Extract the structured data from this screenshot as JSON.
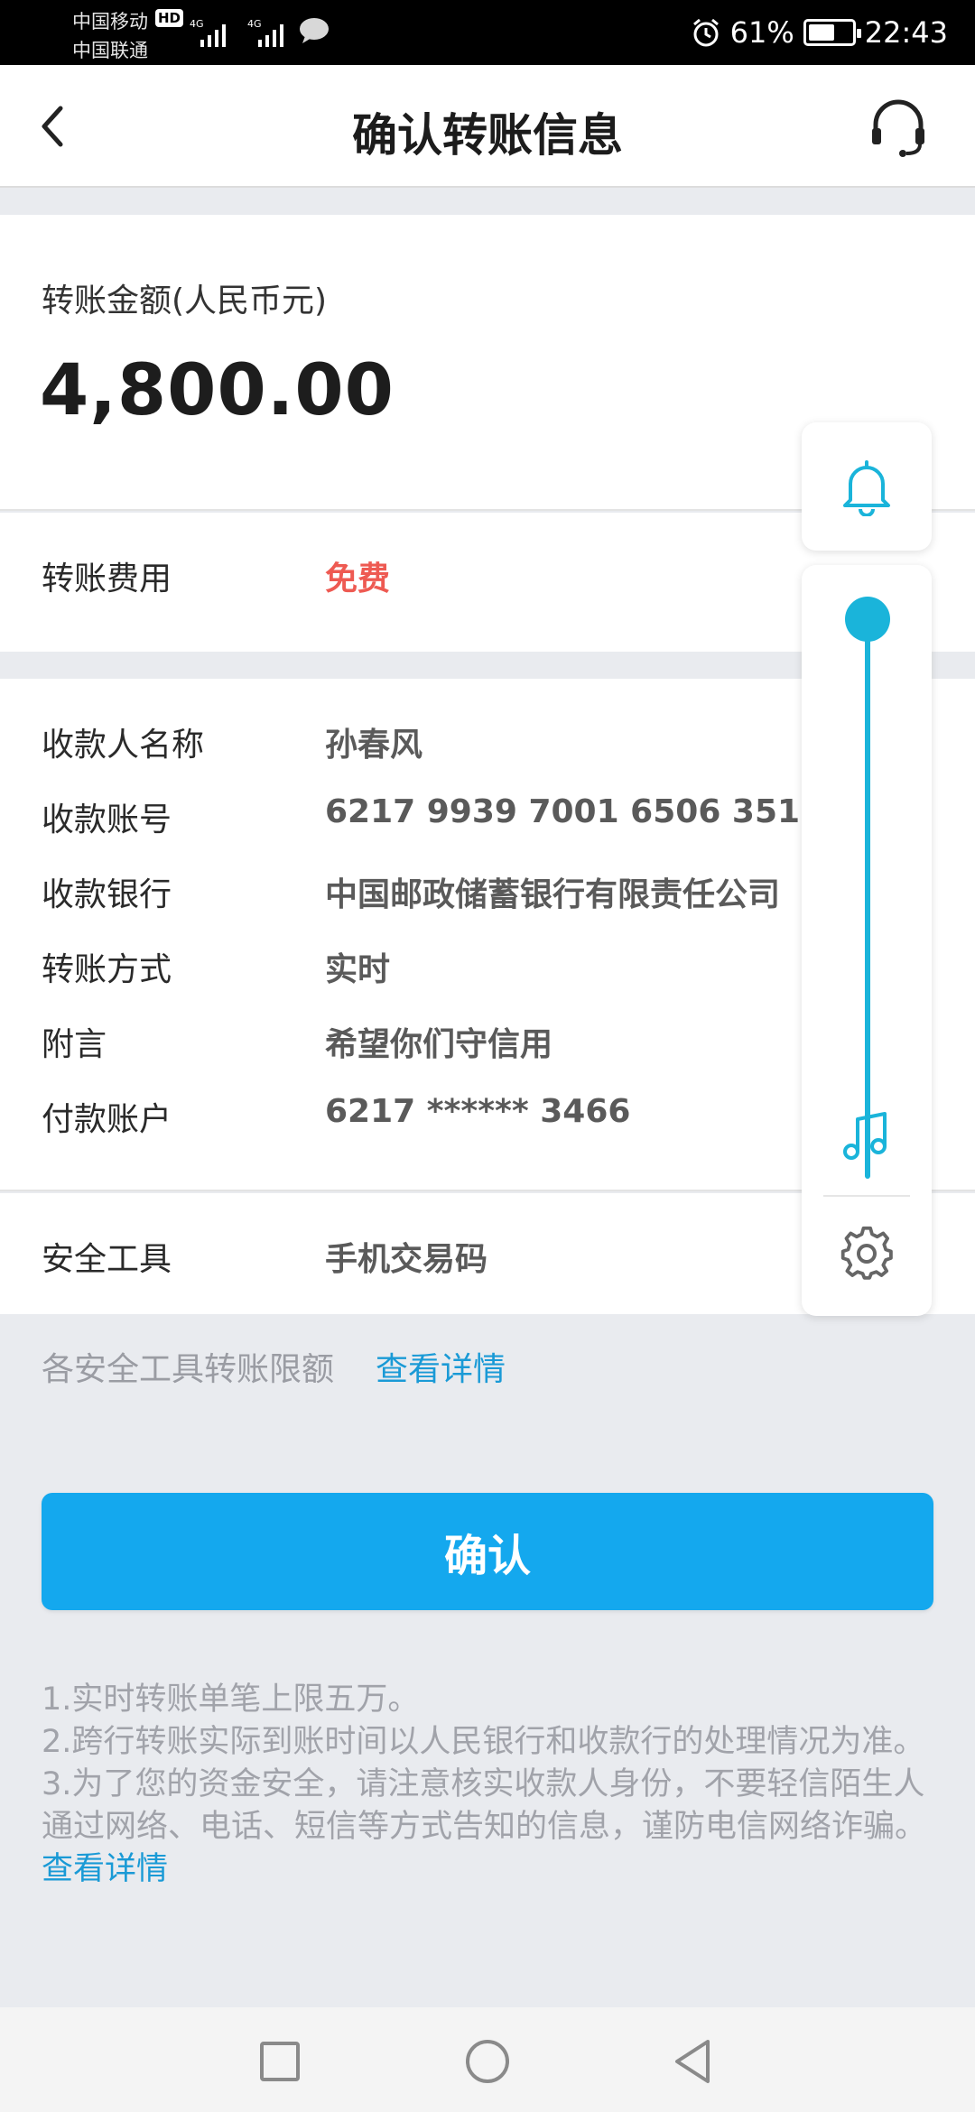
{
  "status_bar": {
    "carrier1": "中国移动",
    "carrier2": "中国联通",
    "hd": "HD",
    "net1": "4G",
    "net2": "4G",
    "battery_percent": "61%",
    "battery_level": 0.61,
    "time": "22:43",
    "icons": [
      "signal-icon",
      "chat-bubble-icon",
      "alarm-icon",
      "battery-icon"
    ]
  },
  "header": {
    "title": "确认转账信息",
    "back_icon": "chevron-left-icon",
    "support_icon": "headset-icon"
  },
  "amount": {
    "label": "转账金额(人民币元)",
    "value": "4,800.00"
  },
  "fee": {
    "label": "转账费用",
    "value": "免费",
    "value_color": "#ee5a52"
  },
  "details": [
    {
      "label": "收款人名称",
      "value": "孙春风"
    },
    {
      "label": "收款账号",
      "value": "6217 9939 7001 6506 351"
    },
    {
      "label": "收款银行",
      "value": "中国邮政储蓄银行有限责任公司"
    },
    {
      "label": "转账方式",
      "value": "实时"
    },
    {
      "label": "附言",
      "value": "希望你们守信用"
    },
    {
      "label": "付款账户",
      "value": "6217 ****** 3466"
    }
  ],
  "security": {
    "label": "安全工具",
    "value": "手机交易码"
  },
  "limit": {
    "text": "各安全工具转账限额",
    "link": "查看详情"
  },
  "confirm_button": "确认",
  "notes": {
    "line1": "1.实时转账单笔上限五万。",
    "line2": "2.跨行转账实际到账时间以人民银行和收款行的处理情况为准。",
    "line3": "3.为了您的资金安全，请注意核实收款人身份，不要轻信陌生人通过网络、电话、短信等方式告知的信息，谨防电信网络诈骗。",
    "link": "查看详情"
  },
  "floating_widget": {
    "icons": [
      "bell-icon",
      "music-note-icon",
      "gear-icon"
    ],
    "volume_level": 1.0
  },
  "colors": {
    "accent": "#14a8ee",
    "link": "#1a9ad6",
    "widget": "#1ab4da",
    "background": "#e9ebef"
  },
  "nav_bar": {
    "icons": [
      "square-icon",
      "circle-icon",
      "triangle-back-icon"
    ]
  }
}
